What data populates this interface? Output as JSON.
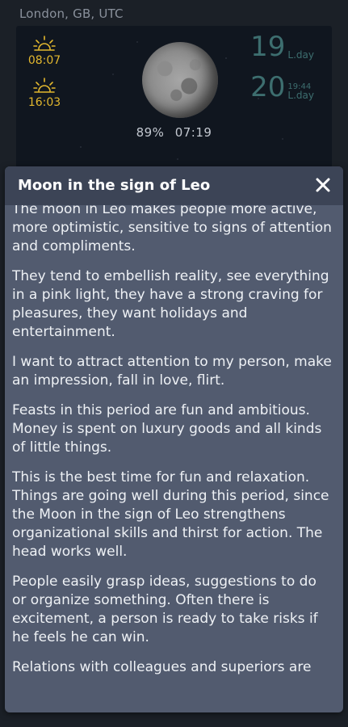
{
  "location": "London, GB, UTC",
  "sun": {
    "sunrise": "08:07",
    "sunset": "16:03",
    "color": "#e2b72e"
  },
  "moon": {
    "illumination": "89%",
    "time": "07:19"
  },
  "lunar_days": [
    {
      "number": "19",
      "time": "",
      "unit": "L.day"
    },
    {
      "number": "20",
      "time": "19:44",
      "unit": "L.day"
    }
  ],
  "modal": {
    "title": "Moon in the sign of Leo",
    "paragraphs": [
      "The moon in Leo makes people more active, more optimistic, sensitive to signs of attention and compliments.",
      "They tend to embellish reality, see everything in a pink light, they have a strong craving for pleasures, they want holidays and entertainment.",
      "I want to attract attention to my person, make an impression, fall in love, flirt.",
      "Feasts in this period are fun and ambitious. Money is spent on luxury goods and all kinds of little things.",
      "This is the best time for fun and relaxation. Things are going well during this period, since the Moon in the sign of Leo strengthens organizational skills and thirst for action. The head works well.",
      "People easily grasp ideas, suggestions to do or organize something. Often there is excitement, a person is ready to take risks if he feels he can win.",
      "Relations with colleagues and superiors are"
    ]
  }
}
